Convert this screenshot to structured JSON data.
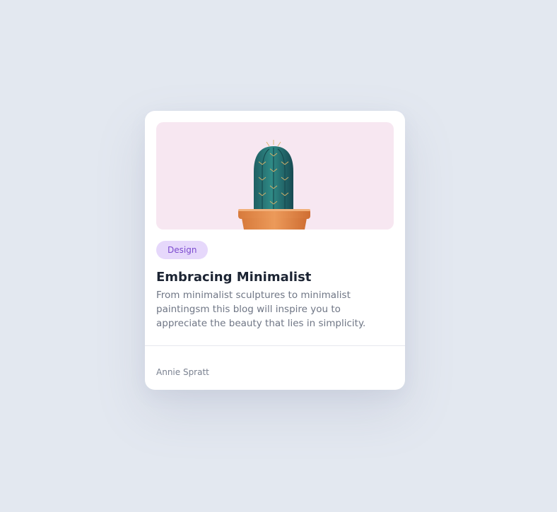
{
  "card": {
    "image": {
      "subject": "cactus-in-pot",
      "background_color": "#f7e7f1"
    },
    "tag": {
      "label": "Design",
      "text_color": "#7c4bcf",
      "background_color": "#e6d8fb"
    },
    "title": "Embracing Minimalist",
    "excerpt": "From minimalist sculptures to minimalist paintingsm this blog will inspire you to appreciate the beauty that lies in simplicity.",
    "author": "Annie Spratt"
  },
  "colors": {
    "page_background": "#e3e8f0",
    "card_background": "#ffffff",
    "title": "#1c2433",
    "body_text": "#6f7685"
  }
}
